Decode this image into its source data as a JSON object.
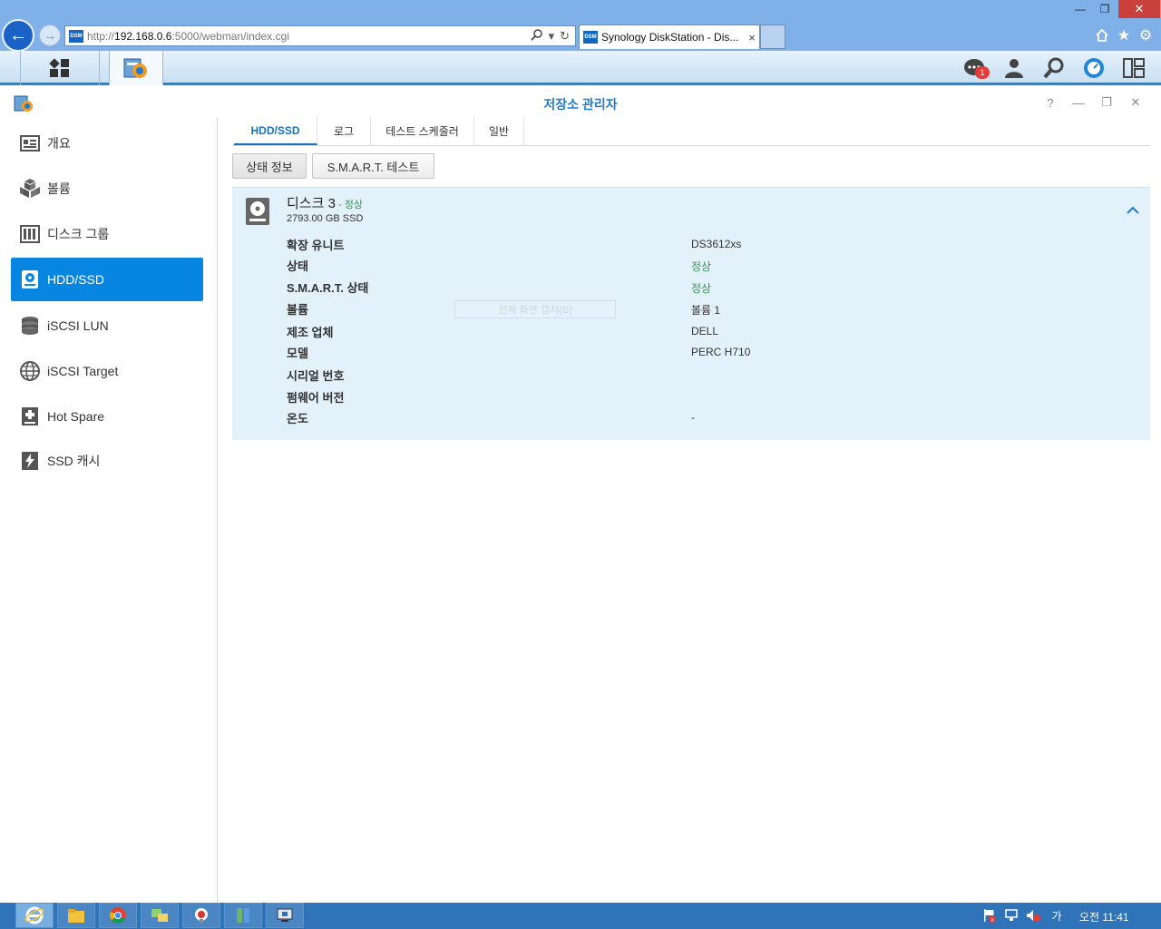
{
  "browser": {
    "url_scheme": "http://",
    "url_host": "192.168.0.6",
    "url_rest": ":5000/webman/index.cgi",
    "favicon_text": "DSM",
    "tab_title": "Synology DiskStation - Dis...",
    "tab_close": "×",
    "win_min": "—",
    "win_max": "❐",
    "win_close": "✕",
    "back_icon": "arrow-left-icon",
    "forward_icon": "arrow-right-icon"
  },
  "dsm": {
    "notification_count": "1"
  },
  "app": {
    "title": "저장소 관리자",
    "help": "?",
    "minimize": "—",
    "maximize": "❐",
    "close": "✕"
  },
  "sidebar": {
    "items": [
      {
        "label": "개요",
        "icon": "overview-icon"
      },
      {
        "label": "볼륨",
        "icon": "volume-icon"
      },
      {
        "label": "디스크 그룹",
        "icon": "disk-group-icon"
      },
      {
        "label": "HDD/SSD",
        "icon": "hdd-icon"
      },
      {
        "label": "iSCSI LUN",
        "icon": "lun-icon"
      },
      {
        "label": "iSCSI Target",
        "icon": "target-icon"
      },
      {
        "label": "Hot Spare",
        "icon": "hot-spare-icon"
      },
      {
        "label": "SSD 캐시",
        "icon": "ssd-cache-icon"
      }
    ],
    "active_index": 3
  },
  "tabs": [
    {
      "label": "HDD/SSD"
    },
    {
      "label": "로그"
    },
    {
      "label": "테스트 스케줄러"
    },
    {
      "label": "일반"
    }
  ],
  "sub_buttons": [
    {
      "label": "상태 정보"
    },
    {
      "label": "S.M.A.R.T. 테스트"
    }
  ],
  "disk": {
    "name": "디스크 3",
    "status_sep": " - ",
    "status": "정상",
    "size": "2793.00 GB SSD",
    "collapse": "^",
    "rows": [
      {
        "label": "확장 유니트",
        "value": "DS3612xs",
        "ok": false
      },
      {
        "label": "상태",
        "value": "정상",
        "ok": true
      },
      {
        "label": "S.M.A.R.T. 상태",
        "value": "정상",
        "ok": true
      },
      {
        "label": "볼륨",
        "value": "볼륨 1",
        "ok": false
      },
      {
        "label": "제조 업체",
        "value": "DELL",
        "ok": false
      },
      {
        "label": "모델",
        "value": "PERC H710",
        "ok": false
      },
      {
        "label": "시리얼 번호",
        "value": "",
        "ok": false
      },
      {
        "label": "펌웨어 버전",
        "value": "",
        "ok": false
      },
      {
        "label": "온도",
        "value": "-",
        "ok": false
      }
    ],
    "ghost_menu": "전체 화면 캡처(S)"
  },
  "taskbar": {
    "ime": "가",
    "clock": "오전 11:41"
  },
  "colors": {
    "accent": "#0686e0",
    "ok_green": "#2f9a4a",
    "panel_bg": "#e3f1fb"
  }
}
